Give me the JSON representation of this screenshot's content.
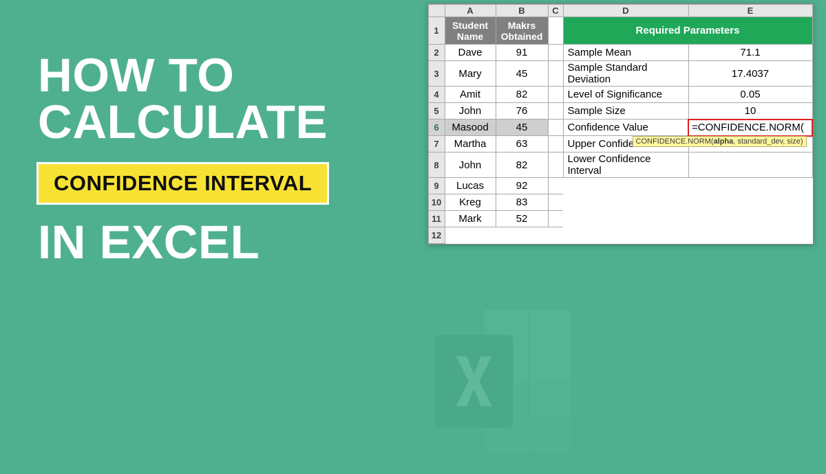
{
  "title": {
    "line1": "HOW TO",
    "line2": "CALCULATE",
    "highlight": "CONFIDENCE INTERVAL",
    "line3": "IN EXCEL"
  },
  "sheet": {
    "columns": [
      "A",
      "B",
      "C",
      "D",
      "E"
    ],
    "rownums": [
      "1",
      "2",
      "3",
      "4",
      "5",
      "6",
      "7",
      "8",
      "9",
      "10",
      "11",
      "12"
    ],
    "header": {
      "student": "Student Name",
      "marks": "Makrs Obtained",
      "req_params": "Required Parameters"
    },
    "students": [
      {
        "name": "Dave",
        "marks": "91"
      },
      {
        "name": "Mary",
        "marks": "45"
      },
      {
        "name": "Amit",
        "marks": "82"
      },
      {
        "name": "John",
        "marks": "76"
      },
      {
        "name": "Masood",
        "marks": "45"
      },
      {
        "name": "Martha",
        "marks": "63"
      },
      {
        "name": "John",
        "marks": "82"
      },
      {
        "name": "Lucas",
        "marks": "92"
      },
      {
        "name": "Kreg",
        "marks": "83"
      },
      {
        "name": "Mark",
        "marks": "52"
      }
    ],
    "params": [
      {
        "label": "Sample Mean",
        "value": "71.1"
      },
      {
        "label": "Sample Standard Deviation",
        "value": "17.4037"
      },
      {
        "label": "Level of Significance",
        "value": "0.05"
      },
      {
        "label": "Sample Size",
        "value": "10"
      },
      {
        "label": "Confidence Value",
        "value": "=CONFIDENCE.NORM("
      },
      {
        "label": "Upper Confiden",
        "value": ""
      },
      {
        "label": "Lower Confidence Interval",
        "value": ""
      }
    ],
    "tooltip": {
      "func": "CONFIDENCE.NORM(",
      "arg1": "alpha",
      "rest": ", standard_dev, size)"
    },
    "selected_row": "6"
  }
}
